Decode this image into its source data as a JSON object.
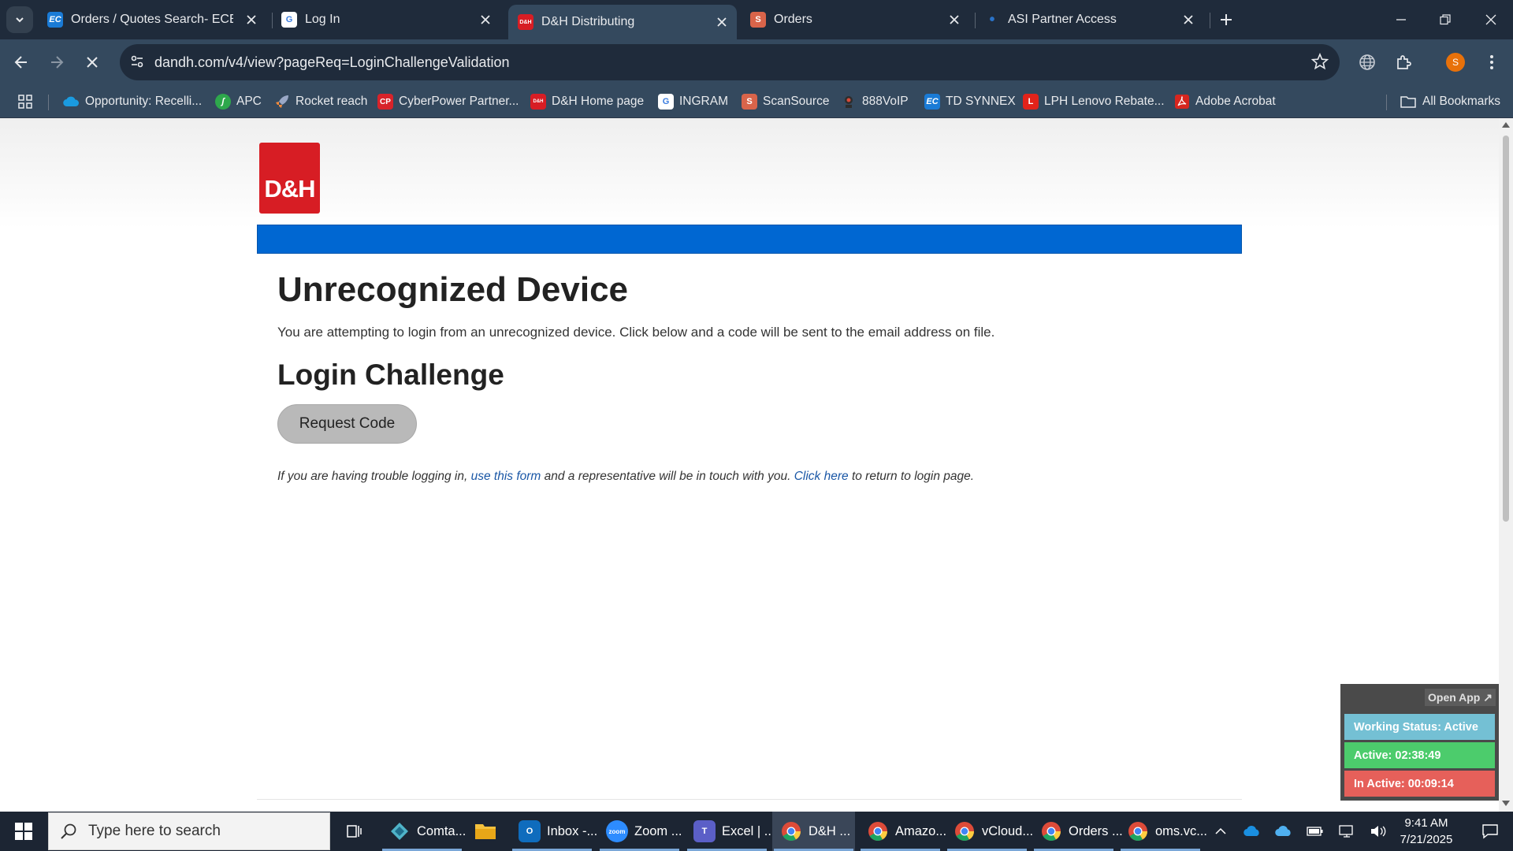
{
  "tabs": [
    {
      "title": "Orders / Quotes Search- ECExpress",
      "favicon": "EC",
      "favicon_color": "#1a7bd6"
    },
    {
      "title": "Log In",
      "favicon": "G",
      "favicon_color": "#3a7ce0"
    },
    {
      "title": "D&H Distributing",
      "favicon": "D&H",
      "favicon_color": "#d71d24"
    },
    {
      "title": "Orders",
      "favicon": "S",
      "favicon_color": "#d9644a"
    },
    {
      "title": "ASI Partner Access",
      "favicon": "•",
      "favicon_color": "#2a73c9"
    }
  ],
  "address_bar": {
    "url": "dandh.com/v4/view?pageReq=LoginChallengeValidation"
  },
  "profile_initial": "S",
  "bookmarks": [
    {
      "label": "Opportunity: Recelli...",
      "icon": "cloud-icon",
      "color": "#1a9be0"
    },
    {
      "label": "APC",
      "icon": "apc-icon",
      "color": "#2ea84c"
    },
    {
      "label": "Rocket reach",
      "icon": "rocket-icon",
      "color": "#9aa8c6"
    },
    {
      "label": "CyberPower Partner...",
      "icon": "CP",
      "color": "#d8232a"
    },
    {
      "label": "D&H Home page",
      "icon": "D&H",
      "color": "#d71d24"
    },
    {
      "label": "INGRAM",
      "icon": "G",
      "color": "#3a7ce0"
    },
    {
      "label": "ScanSource",
      "icon": "S",
      "color": "#d9644a"
    },
    {
      "label": "888VoIP",
      "icon": "voip-icon",
      "color": "#d84a3a"
    },
    {
      "label": "TD SYNNEX",
      "icon": "EC",
      "color": "#1a7bd6"
    },
    {
      "label": "LPH Lenovo Rebate...",
      "icon": "L",
      "color": "#e2231a"
    },
    {
      "label": "Adobe Acrobat",
      "icon": "pdf-icon",
      "color": "#d7261f"
    }
  ],
  "all_bookmarks_label": "All Bookmarks",
  "page": {
    "logo_text": "D&H",
    "heading": "Unrecognized Device",
    "description": "You are attempting to login from an unrecognized device. Click below and a code will be sent to the email address on file.",
    "subheading": "Login Challenge",
    "request_button": "Request Code",
    "help_prefix": "If you are having trouble logging in,",
    "help_link_form": "use this form",
    "help_middle": "and a representative will be in touch with you.",
    "help_link_click": "Click here",
    "help_suffix": "to return to login page."
  },
  "widget": {
    "open_app": "Open App ↗",
    "working_status": "Working Status: Active",
    "active_time": "Active: 02:38:49",
    "inactive_time": "In Active: 00:09:14",
    "colors": {
      "working": "#74c0d4",
      "active": "#4ccc6c",
      "inactive": "#e6605a"
    }
  },
  "taskbar": {
    "search_placeholder": "Type here to search",
    "apps": [
      {
        "label": "Comta...",
        "icon": "comtalk-icon",
        "color": "#1f6e8c"
      },
      {
        "label": "Inbox -...",
        "icon": "outlook-icon",
        "color": "#0f6cbd"
      },
      {
        "label": "Zoom ...",
        "icon": "zoom-icon",
        "color": "#2d8cff"
      },
      {
        "label": "Excel | ...",
        "icon": "teams-icon",
        "color": "#5b5fc7"
      },
      {
        "label": "D&H ...",
        "icon": "chrome-icon",
        "color": "#dd4b39"
      },
      {
        "label": "Amazo...",
        "icon": "chrome-icon",
        "color": "#dd4b39"
      },
      {
        "label": "vCloud...",
        "icon": "chrome-icon",
        "color": "#dd4b39"
      },
      {
        "label": "Orders ...",
        "icon": "chrome-icon",
        "color": "#dd4b39"
      },
      {
        "label": "oms.vc...",
        "icon": "chrome-icon",
        "color": "#dd4b39"
      }
    ],
    "time": "9:41 AM",
    "date": "7/21/2025"
  }
}
